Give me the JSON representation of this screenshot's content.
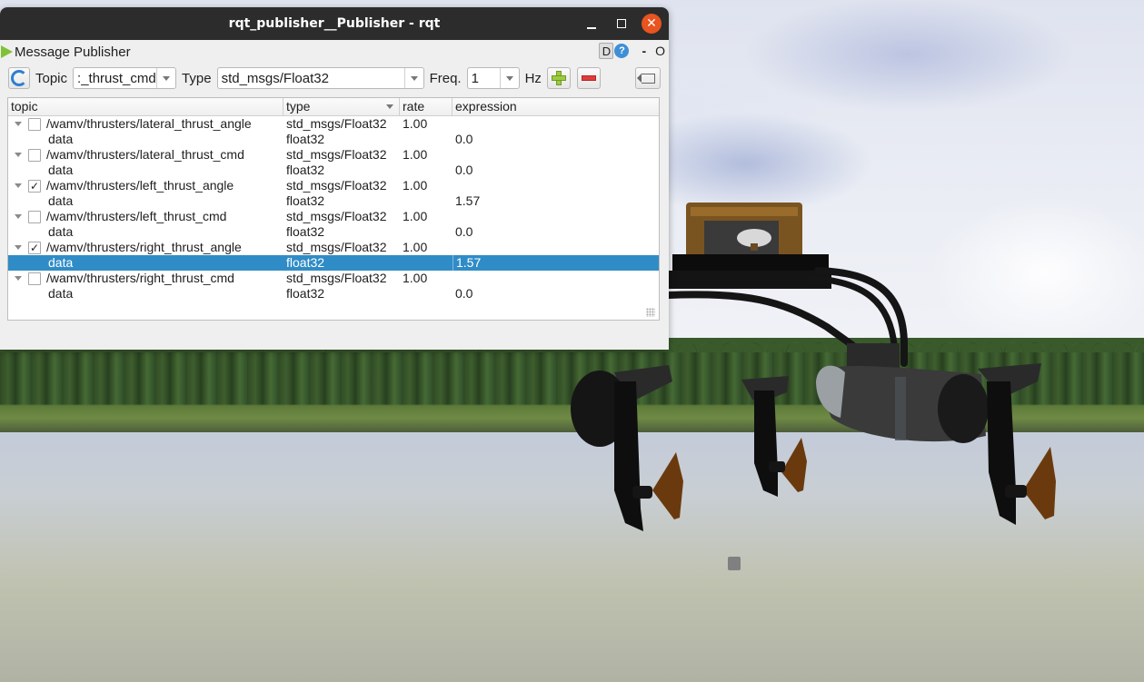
{
  "window": {
    "title": "rqt_publisher__Publisher - rqt",
    "controls": {
      "minimize": "_",
      "maximize": "□",
      "close": "✕"
    }
  },
  "plugin": {
    "title": "Message Publisher",
    "header_buttons": {
      "d_label": "D",
      "help_label": "?",
      "dash_label": "-",
      "o_label": "O"
    }
  },
  "toolbar": {
    "topic_label": "Topic",
    "topic_value": ":_thrust_cmd",
    "type_label": "Type",
    "type_value": "std_msgs/Float32",
    "freq_label": "Freq.",
    "freq_value": "1",
    "hz_label": "Hz",
    "icons": {
      "refresh": "refresh-icon",
      "add": "plus-icon",
      "remove": "minus-icon",
      "clear": "clear-icon"
    }
  },
  "table": {
    "columns": [
      "topic",
      "type",
      "rate",
      "expression"
    ],
    "rows": [
      {
        "topic": "/wamv/thrusters/lateral_thrust_angle",
        "type": "std_msgs/Float32",
        "rate": "1.00",
        "checked": false,
        "check_mark": "",
        "child": {
          "name": "data",
          "type": "float32",
          "expression": "0.0",
          "selected": false
        }
      },
      {
        "topic": "/wamv/thrusters/lateral_thrust_cmd",
        "type": "std_msgs/Float32",
        "rate": "1.00",
        "checked": false,
        "check_mark": "",
        "child": {
          "name": "data",
          "type": "float32",
          "expression": "0.0",
          "selected": false
        }
      },
      {
        "topic": "/wamv/thrusters/left_thrust_angle",
        "type": "std_msgs/Float32",
        "rate": "1.00",
        "checked": true,
        "check_mark": "✓",
        "child": {
          "name": "data",
          "type": "float32",
          "expression": "1.57",
          "selected": false
        }
      },
      {
        "topic": "/wamv/thrusters/left_thrust_cmd",
        "type": "std_msgs/Float32",
        "rate": "1.00",
        "checked": false,
        "check_mark": "",
        "child": {
          "name": "data",
          "type": "float32",
          "expression": "0.0",
          "selected": false
        }
      },
      {
        "topic": "/wamv/thrusters/right_thrust_angle",
        "type": "std_msgs/Float32",
        "rate": "1.00",
        "checked": true,
        "check_mark": "✓",
        "child": {
          "name": "data",
          "type": "float32",
          "expression": "1.57",
          "selected": true
        }
      },
      {
        "topic": "/wamv/thrusters/right_thrust_cmd",
        "type": "std_msgs/Float32",
        "rate": "1.00",
        "checked": false,
        "check_mark": "",
        "child": {
          "name": "data",
          "type": "float32",
          "expression": "0.0",
          "selected": false
        }
      }
    ]
  },
  "colors": {
    "titlebar": "#2c2c2c",
    "close_button": "#e95420",
    "selection": "#308cc6",
    "play_icon": "#7fc23a",
    "add_icon": "#9ccb3f",
    "remove_icon": "#e03b3b"
  },
  "scene": {
    "description": "Gazebo 3D view of WAM-V vessel with thrusters over water, trees in background"
  }
}
